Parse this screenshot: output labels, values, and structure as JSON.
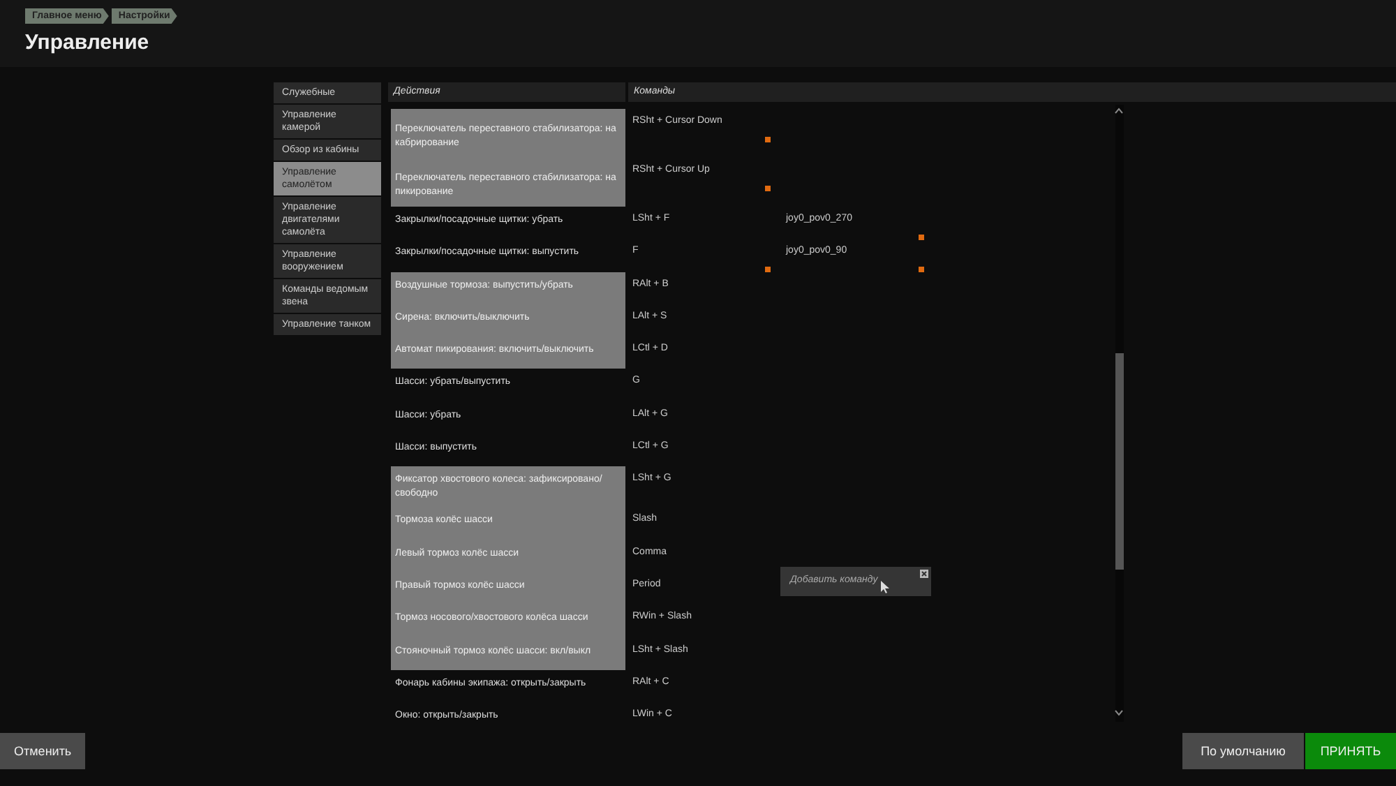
{
  "breadcrumb": [
    "Главное меню",
    "Настройки"
  ],
  "title": "Управление",
  "sidebar": {
    "items": [
      {
        "label": "Служебные",
        "selected": false
      },
      {
        "label": "Управление камерой",
        "selected": false
      },
      {
        "label": "Обзор из кабины",
        "selected": false
      },
      {
        "label": "Управление самолётом",
        "selected": true
      },
      {
        "label": "Управление двигателями самолёта",
        "selected": false
      },
      {
        "label": "Управление вооружением",
        "selected": false
      },
      {
        "label": "Команды ведомым звена",
        "selected": false
      },
      {
        "label": "Управление танком",
        "selected": false
      }
    ]
  },
  "table": {
    "columns": [
      "Действия",
      "Команды"
    ],
    "rows": [
      {
        "action": "Переключатель переставного стабилизатора: на кабрирование",
        "highlighted": true,
        "keys": [
          {
            "text": "RSht + Cursor Down",
            "marked": true
          }
        ]
      },
      {
        "action": "Переключатель переставного стабилизатора: на пикирование",
        "highlighted": true,
        "keys": [
          {
            "text": "RSht + Cursor Up",
            "marked": true
          }
        ]
      },
      {
        "action": "Закрылки/посадочные щитки: убрать",
        "highlighted": false,
        "keys": [
          {
            "text": "LSht + F",
            "marked": false
          },
          {
            "text": "joy0_pov0_270",
            "marked": true
          }
        ]
      },
      {
        "action": "Закрылки/посадочные щитки: выпустить",
        "highlighted": false,
        "keys": [
          {
            "text": "F",
            "marked": true
          },
          {
            "text": "joy0_pov0_90",
            "marked": true
          }
        ]
      },
      {
        "action": "Воздушные тормоза: выпустить/убрать",
        "highlighted": true,
        "keys": [
          {
            "text": "RAlt + B",
            "marked": false
          }
        ]
      },
      {
        "action": "Сирена: включить/выключить",
        "highlighted": true,
        "keys": [
          {
            "text": "LAlt + S",
            "marked": false
          }
        ]
      },
      {
        "action": "Автомат пикирования: включить/выключить",
        "highlighted": true,
        "keys": [
          {
            "text": "LCtl + D",
            "marked": false
          }
        ]
      },
      {
        "action": "Шасси: убрать/выпустить",
        "highlighted": false,
        "keys": [
          {
            "text": "G",
            "marked": false
          }
        ]
      },
      {
        "action": "Шасси: убрать",
        "highlighted": false,
        "keys": [
          {
            "text": "LAlt + G",
            "marked": false
          }
        ]
      },
      {
        "action": "Шасси: выпустить",
        "highlighted": false,
        "keys": [
          {
            "text": "LCtl + G",
            "marked": false
          }
        ]
      },
      {
        "action": "Фиксатор хвостового колеса: зафиксировано/свободно",
        "highlighted": true,
        "keys": [
          {
            "text": "LSht + G",
            "marked": false
          }
        ]
      },
      {
        "action": "Тормоза колёс шасси",
        "highlighted": true,
        "keys": [
          {
            "text": "Slash",
            "marked": false
          }
        ]
      },
      {
        "action": "Левый тормоз колёс шасси",
        "highlighted": true,
        "keys": [
          {
            "text": "Comma",
            "marked": false
          }
        ]
      },
      {
        "action": "Правый тормоз колёс шасси",
        "highlighted": true,
        "keys": [
          {
            "text": "Period",
            "marked": false
          }
        ]
      },
      {
        "action": "Тормоз носового/хвостового колёса шасси",
        "highlighted": true,
        "keys": [
          {
            "text": "RWin + Slash",
            "marked": false
          }
        ]
      },
      {
        "action": "Стояночный тормоз колёс шасси: вкл/выкл",
        "highlighted": true,
        "keys": [
          {
            "text": "LSht + Slash",
            "marked": false
          }
        ]
      },
      {
        "action": "Фонарь кабины экипажа: открыть/закрыть",
        "highlighted": false,
        "keys": [
          {
            "text": "RAlt + C",
            "marked": false
          }
        ]
      },
      {
        "action": "Окно: открыть/закрыть",
        "highlighted": false,
        "keys": [
          {
            "text": "LWin + C",
            "marked": false
          }
        ]
      }
    ]
  },
  "popup": {
    "label": "Добавить команду"
  },
  "buttons": {
    "cancel": "Отменить",
    "defaults": "По умолчанию",
    "accept": "ПРИНЯТЬ"
  }
}
